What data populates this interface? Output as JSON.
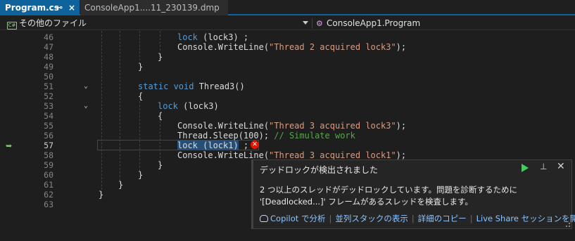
{
  "tabs": {
    "active_label": "Program.cs",
    "pin_glyph": "⊸",
    "close_glyph": "×",
    "inactive_label": "ConsoleApp1....11_230139.dmp"
  },
  "navbar": {
    "file_icon": "C#",
    "left_label": "その他のファイル",
    "right_label": "ConsoleApp1.Program"
  },
  "editor": {
    "current_line": 57,
    "lines": [
      {
        "n": "46",
        "segs": [
          [
            "kw",
            "lock"
          ],
          [
            "",
            "("
          ],
          [
            "",
            "lock3"
          ],
          [
            "",
            ")"
          ],
          [
            "",
            " ;"
          ]
        ]
      },
      {
        "n": "47",
        "segs": []
      },
      {
        "n": "48",
        "segs": []
      },
      {
        "n": "49",
        "segs": []
      },
      {
        "n": "50",
        "segs": []
      },
      {
        "n": "51",
        "segs": []
      },
      {
        "n": "52",
        "segs": []
      },
      {
        "n": "53",
        "segs": []
      },
      {
        "n": "54",
        "segs": []
      },
      {
        "n": "55",
        "segs": []
      },
      {
        "n": "56",
        "segs": []
      },
      {
        "n": "57",
        "segs": []
      },
      {
        "n": "58",
        "segs": []
      },
      {
        "n": "59",
        "segs": []
      },
      {
        "n": "60",
        "segs": []
      },
      {
        "n": "61",
        "segs": []
      },
      {
        "n": "62",
        "segs": []
      },
      {
        "n": "63",
        "segs": []
      }
    ],
    "code": {
      "l46_kw": "lock",
      "l46_rest": " (lock3) ;",
      "l47_a": "Console.WriteLine(",
      "l47_s": "\"Thread 2 acquired lock3\"",
      "l47_b": ");",
      "l48": "}",
      "l49": "}",
      "l51_kw": "static void",
      "l51_rest": " Thread3()",
      "l52": "{",
      "l53_kw": "lock",
      "l53_rest": " (lock3)",
      "l54": "{",
      "l55_a": "Console.WriteLine(",
      "l55_s": "\"Thread 3 acquired lock3\"",
      "l55_b": ");",
      "l56_a": "Thread.Sleep(100); ",
      "l56_c": "// Simulate work",
      "l57_hl": "lock (lock1)",
      "l57_rest": " ;",
      "l58_a": "Console.WriteLine(",
      "l58_s": "\"Thread 3 acquired lock1\"",
      "l58_b": ");",
      "l59": "}",
      "l60": "}",
      "l61": "}",
      "l62": "}"
    },
    "error_glyph": "✕"
  },
  "popup": {
    "title": "デッドロックが検出されました",
    "pin_glyph": "⊥",
    "close_glyph": "✕",
    "message": "2 つ以上のスレッドがデッドロックしています。問題を診断するために '[Deadlocked...]' フレームがあるスレッドを検査します。",
    "links": {
      "copilot": "Copilot で分析",
      "parallel_stacks": "並列スタックの表示",
      "copy_details": "詳細のコピー",
      "live_share": "Live Share セッションを開始..."
    },
    "separator": "|"
  }
}
